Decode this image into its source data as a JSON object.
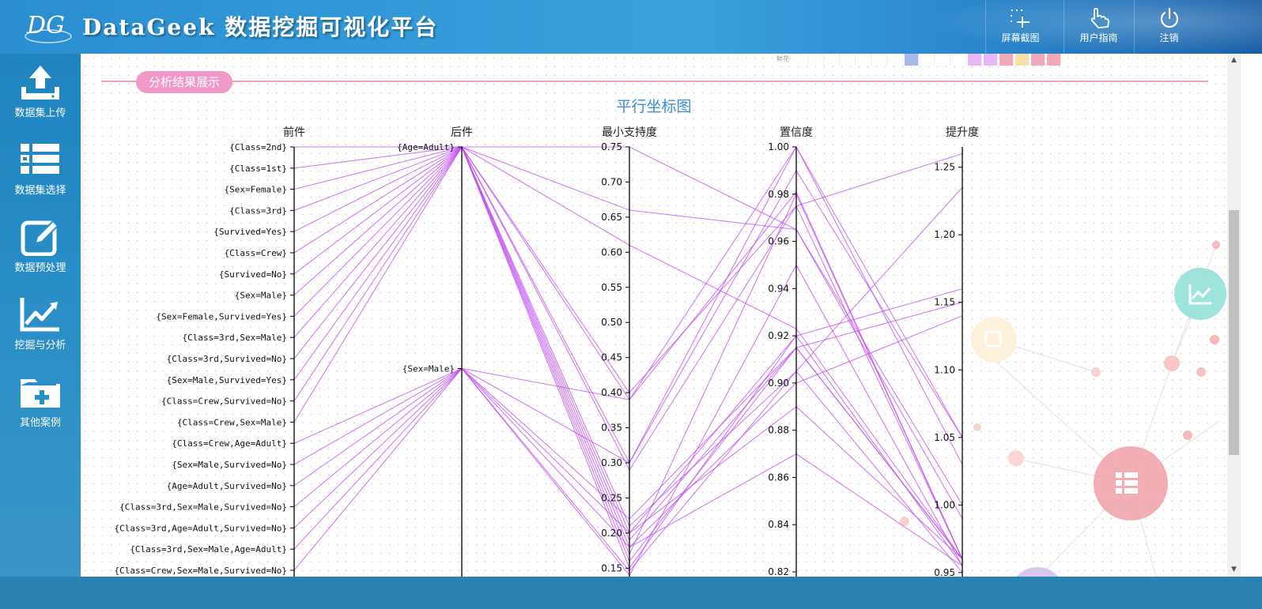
{
  "header": {
    "logo_text": "DG",
    "app_title": "DataGeek 数据挖掘可视化平台",
    "buttons": [
      {
        "label": "屏幕截图",
        "icon": "screenshot-crosshair-icon"
      },
      {
        "label": "用户指南",
        "icon": "hand-pointer-icon"
      },
      {
        "label": "注销",
        "icon": "power-icon"
      }
    ]
  },
  "sidebar": {
    "items": [
      {
        "label": "数据集上传",
        "icon": "upload-icon"
      },
      {
        "label": "数据集选择",
        "icon": "list-icon"
      },
      {
        "label": "数据预处理",
        "icon": "edit-icon"
      },
      {
        "label": "挖掘与分析",
        "icon": "chart-line-icon"
      },
      {
        "label": "其他案例",
        "icon": "folder-add-icon"
      }
    ]
  },
  "content": {
    "previous_legend_label": "鲜花",
    "previous_legend_colors": [
      "#ffffff",
      "#ffffff",
      "#ffffff",
      "#ffffff",
      "#ffffff",
      "#ffffff",
      "#ffffff",
      "#aab9ea",
      "#ffffff",
      "#ffffff",
      "#ffffff",
      "#e6b8f5",
      "#e6b8f5",
      "#f2a8b8",
      "#f7e0a8",
      "#f2a8b8",
      "#f2a8b8"
    ],
    "section_label": "分析结果展示",
    "chart_title": "平行坐标图"
  },
  "chart_data": {
    "type": "parallel_coordinates",
    "title": "平行坐标图",
    "line_color": "#c050f0",
    "axes": [
      {
        "name": "前件",
        "kind": "category",
        "categories": [
          "{Class=2nd}",
          "{Class=1st}",
          "{Sex=Female}",
          "{Class=3rd}",
          "{Survived=Yes}",
          "{Class=Crew}",
          "{Survived=No}",
          "{Sex=Male}",
          "{Sex=Female,Survived=Yes}",
          "{Class=3rd,Sex=Male}",
          "{Class=3rd,Survived=No}",
          "{Sex=Male,Survived=Yes}",
          "{Class=Crew,Survived=No}",
          "{Class=Crew,Sex=Male}",
          "{Class=Crew,Age=Adult}",
          "{Sex=Male,Survived=No}",
          "{Age=Adult,Survived=No}",
          "{Class=3rd,Sex=Male,Survived=No}",
          "{Class=3rd,Age=Adult,Survived=No}",
          "{Class=3rd,Sex=Male,Age=Adult}",
          "{Class=Crew,Sex=Male,Survived=No}"
        ]
      },
      {
        "name": "后件",
        "kind": "category",
        "categories": [
          "{Age=Adult}",
          "{Sex=Male}"
        ]
      },
      {
        "name": "最小支持度",
        "kind": "number",
        "ticks": [
          "0.75",
          "0.70",
          "0.65",
          "0.60",
          "0.55",
          "0.50",
          "0.45",
          "0.40",
          "0.35",
          "0.30",
          "0.25",
          "0.20",
          "0.15"
        ],
        "range": [
          0.75,
          0.138
        ]
      },
      {
        "name": "置信度",
        "kind": "number",
        "ticks": [
          "1.00",
          "0.98",
          "0.96",
          "0.94",
          "0.92",
          "0.90",
          "0.88",
          "0.86",
          "0.84",
          "0.82"
        ],
        "range": [
          1.0,
          0.818
        ]
      },
      {
        "name": "提升度",
        "kind": "number",
        "ticks": [
          "1.25",
          "1.20",
          "1.15",
          "1.10",
          "1.05",
          "1.00",
          "0.95"
        ],
        "range": [
          1.265,
          0.947
        ]
      }
    ],
    "rules": [
      {
        "antecedent": "{Class=2nd}",
        "consequent": "{Age=Adult}",
        "support": 0.75,
        "confidence": 0.965,
        "lift": 1.0
      },
      {
        "antecedent": "{Class=1st}",
        "consequent": "{Age=Adult}",
        "support": 0.66,
        "confidence": 0.965,
        "lift": 0.99
      },
      {
        "antecedent": "{Sex=Female}",
        "consequent": "{Age=Adult}",
        "support": 0.61,
        "confidence": 0.923,
        "lift": 0.96
      },
      {
        "antecedent": "{Class=3rd}",
        "consequent": "{Age=Adult}",
        "support": 0.4,
        "confidence": 0.975,
        "lift": 0.96
      },
      {
        "antecedent": "{Survived=Yes}",
        "consequent": "{Age=Adult}",
        "support": 0.39,
        "confidence": 0.981,
        "lift": 0.96
      },
      {
        "antecedent": "{Class=Crew}",
        "consequent": "{Age=Adult}",
        "support": 0.3,
        "confidence": 1.0,
        "lift": 1.03
      },
      {
        "antecedent": "{Survived=No}",
        "consequent": "{Age=Adult}",
        "support": 0.29,
        "confidence": 0.975,
        "lift": 1.26
      },
      {
        "antecedent": "{Sex=Male}",
        "consequent": "{Age=Adult}",
        "support": 0.21,
        "confidence": 0.905,
        "lift": 1.235
      },
      {
        "antecedent": "{Sex=Female,Survived=Yes}",
        "consequent": "{Age=Adult}",
        "support": 0.2,
        "confidence": 0.92,
        "lift": 1.16
      },
      {
        "antecedent": "{Class=3rd,Sex=Male}",
        "consequent": "{Age=Adult}",
        "support": 0.19,
        "confidence": 0.915,
        "lift": 1.15
      },
      {
        "antecedent": "{Class=3rd,Survived=No}",
        "consequent": "{Age=Adult}",
        "support": 0.18,
        "confidence": 0.9,
        "lift": 1.14
      },
      {
        "antecedent": "{Sex=Male,Survived=Yes}",
        "consequent": "{Age=Adult}",
        "support": 0.17,
        "confidence": 0.98,
        "lift": 0.96
      },
      {
        "antecedent": "{Class=Crew,Survived=No}",
        "consequent": "{Age=Adult}",
        "support": 0.16,
        "confidence": 0.915,
        "lift": 0.96
      },
      {
        "antecedent": "{Class=Crew,Sex=Male}",
        "consequent": "{Age=Adult}",
        "support": 0.15,
        "confidence": 0.92,
        "lift": 0.955
      },
      {
        "antecedent": "{Class=Crew,Age=Adult}",
        "consequent": "{Sex=Male}",
        "support": 0.39,
        "confidence": 1.0,
        "lift": 1.05
      },
      {
        "antecedent": "{Sex=Male,Survived=No}",
        "consequent": "{Sex=Male}",
        "support": 0.3,
        "confidence": 0.99,
        "lift": 1.05
      },
      {
        "antecedent": "{Age=Adult,Survived=No}",
        "consequent": "{Sex=Male}",
        "support": 0.22,
        "confidence": 0.915,
        "lift": 0.96
      },
      {
        "antecedent": "{Class=3rd,Sex=Male,Survived=No}",
        "consequent": "{Sex=Male}",
        "support": 0.2,
        "confidence": 0.89,
        "lift": 0.96
      },
      {
        "antecedent": "{Class=3rd,Age=Adult,Survived=No}",
        "consequent": "{Sex=Male}",
        "support": 0.18,
        "confidence": 0.87,
        "lift": 0.955
      },
      {
        "antecedent": "{Class=3rd,Sex=Male,Age=Adult}",
        "consequent": "{Sex=Male}",
        "support": 0.146,
        "confidence": 0.905,
        "lift": 0.95
      },
      {
        "antecedent": "{Class=Crew,Sex=Male,Survived=No}",
        "consequent": "{Sex=Male}",
        "support": 0.14,
        "confidence": 0.95,
        "lift": 0.955
      }
    ]
  }
}
